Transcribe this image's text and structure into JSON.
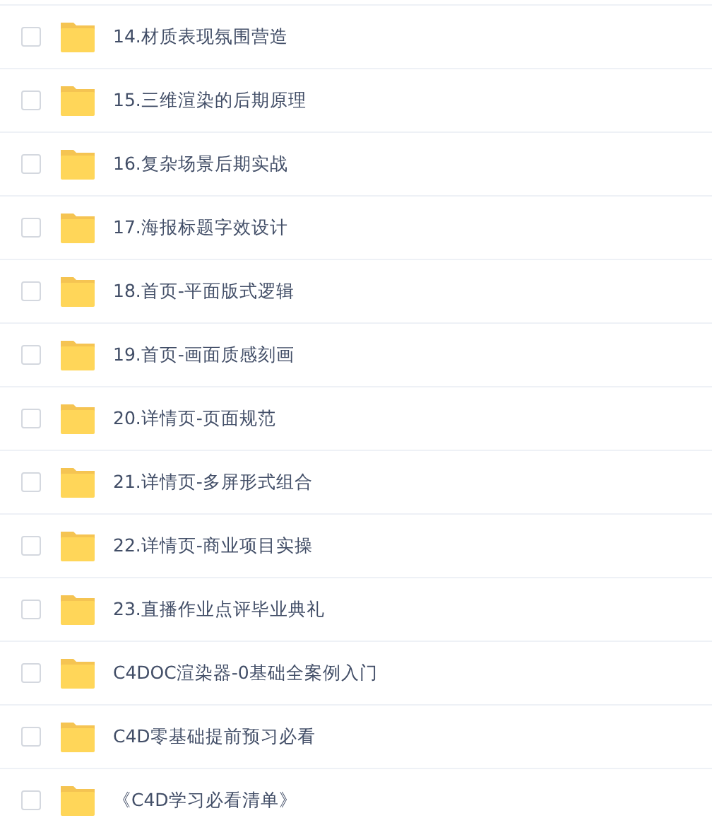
{
  "files": [
    {
      "name": "14.材质表现氛围营造",
      "checked": false
    },
    {
      "name": "15.三维渲染的后期原理",
      "checked": false
    },
    {
      "name": "16.复杂场景后期实战",
      "checked": false
    },
    {
      "name": "17.海报标题字效设计",
      "checked": false
    },
    {
      "name": "18.首页-平面版式逻辑",
      "checked": false
    },
    {
      "name": "19.首页-画面质感刻画",
      "checked": false
    },
    {
      "name": "20.详情页-页面规范",
      "checked": false
    },
    {
      "name": "21.详情页-多屏形式组合",
      "checked": false
    },
    {
      "name": "22.详情页-商业项目实操",
      "checked": false
    },
    {
      "name": "23.直播作业点评毕业典礼",
      "checked": false
    },
    {
      "name": "C4DOC渲染器-0基础全案例入门",
      "checked": false
    },
    {
      "name": "C4D零基础提前预习必看",
      "checked": false
    },
    {
      "name": "《C4D学习必看清单》",
      "checked": false
    }
  ]
}
